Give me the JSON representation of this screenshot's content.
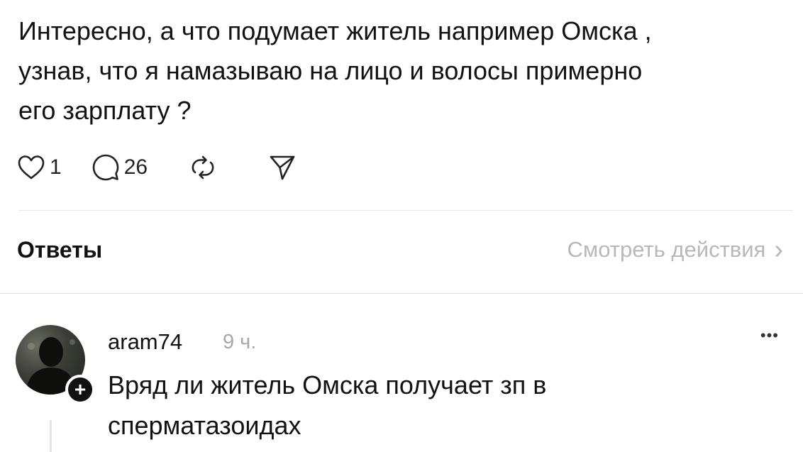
{
  "post": {
    "lines": [
      "Интересно, а что подумает житель например Омска ,",
      "узнав,  что я намазываю на лицо и волосы примерно",
      "его зарплату ?"
    ],
    "likes": "1",
    "comments": "26"
  },
  "replies_section": {
    "title": "Ответы",
    "view_activity": "Смотреть действия",
    "chevron": "›"
  },
  "reply": {
    "username": "aram74",
    "time": "9 ч.",
    "more": "•••",
    "follow": "+",
    "lines": [
      "Вряд ли житель Омска получает зп в",
      "сперматазоидах"
    ]
  },
  "icons": {
    "like": "heart-icon",
    "comment": "comment-bubble-icon",
    "repost": "repost-icon",
    "share": "send-icon"
  }
}
